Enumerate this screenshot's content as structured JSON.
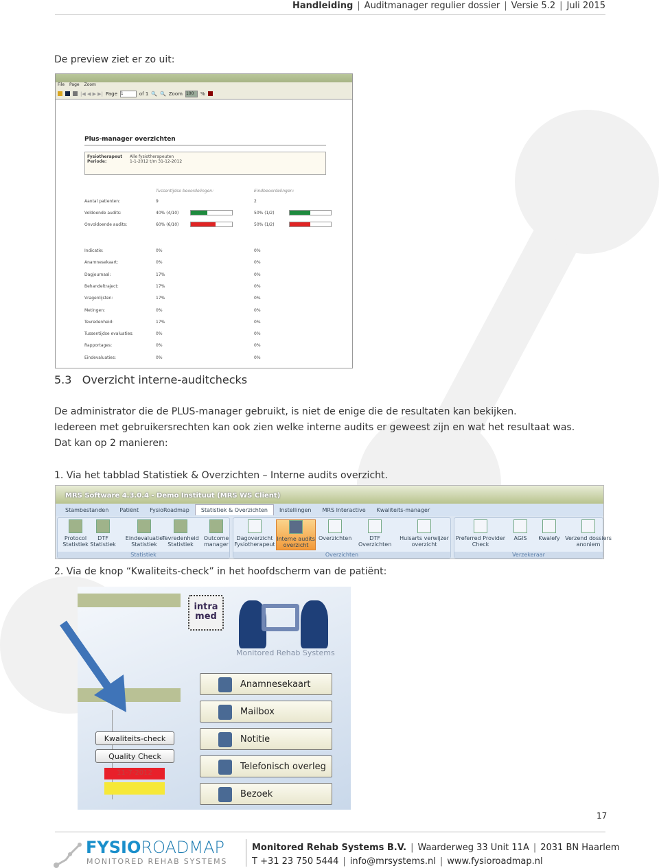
{
  "header": {
    "doc": "Handleiding",
    "title": "Auditmanager regulier dossier",
    "version": "Versie 5.2",
    "date": "Juli 2015"
  },
  "intro": "De preview ziet er zo uit:",
  "preview": {
    "menu": [
      "File",
      "Page",
      "Zoom"
    ],
    "page_label": "Page",
    "page_value": "1",
    "page_of": "of 1",
    "zoom_label": "Zoom",
    "zoom_value": "100",
    "zoom_unit": "%",
    "report_title": "Plus-manager overzichten",
    "therapist_label": "Fysiotherapeut",
    "therapist_value": "Alle fysiotherapeuten",
    "period_label": "Periode:",
    "period_value": "1-1-2012 t/m 31-12-2012",
    "col1": "Tussentijdse beoordelingen:",
    "col2": "Eindbeoordelingen:",
    "summary": [
      {
        "label": "Aantal patienten:",
        "v1": "9",
        "v2": "2"
      },
      {
        "label": "Voldoende audits:",
        "v1": "40% (4/10)",
        "v2": "50% (1/2)",
        "p1": 40,
        "p2": 50,
        "color": "#1e8a3e"
      },
      {
        "label": "Onvoldoende audits:",
        "v1": "60% (6/10)",
        "v2": "50% (1/2)",
        "p1": 60,
        "p2": 50,
        "color": "#e02424"
      }
    ],
    "rows": [
      {
        "label": "Indicatie:",
        "v1": "0%",
        "v2": "0%"
      },
      {
        "label": "Anamnesekaart:",
        "v1": "0%",
        "v2": "0%"
      },
      {
        "label": "Dagjournaal:",
        "v1": "17%",
        "v2": "0%"
      },
      {
        "label": "Behandeltraject:",
        "v1": "17%",
        "v2": "0%"
      },
      {
        "label": "Vragenlijsten:",
        "v1": "17%",
        "v2": "0%"
      },
      {
        "label": "Metingen:",
        "v1": "0%",
        "v2": "0%"
      },
      {
        "label": "Tevredenheid:",
        "v1": "17%",
        "v2": "0%"
      },
      {
        "label": "Tussentijdse evaluaties:",
        "v1": "0%",
        "v2": "0%"
      },
      {
        "label": "Rapportages:",
        "v1": "0%",
        "v2": "0%"
      },
      {
        "label": "Eindevaluaties:",
        "v1": "0%",
        "v2": "0%"
      }
    ]
  },
  "section": {
    "number": "5.3",
    "title": "Overzicht interne-auditchecks"
  },
  "para": [
    "De administrator die de PLUS-manager gebruikt, is niet de enige die de resultaten kan bekijken.",
    "Iedereen met gebruikersrechten kan ook zien welke interne audits er geweest zijn en wat het resultaat was.",
    "Dat kan op 2 manieren:"
  ],
  "step1": "1.   Via het tabblad Statistiek & Overzichten – Interne audits overzicht.",
  "ribbon": {
    "title": "MRS Software 4.3.0.4 - Demo Instituut (MRS WS Client)",
    "tabs": [
      "Stambestanden",
      "Patiënt",
      "FysioRoadmap",
      "Statistiek & Overzichten",
      "Instellingen",
      "MRS Interactive",
      "Kwaliteits-manager"
    ],
    "groups": [
      {
        "label": "Statistiek",
        "buttons": [
          "Protocol Statistiek",
          "DTF Statistiek",
          "Eindevaluatie Statistiek",
          "Tevredenheid Statistiek",
          "Outcome manager"
        ]
      },
      {
        "label": "Overzichten",
        "buttons": [
          "Dagoverzicht Fysiotherapeut",
          "Interne audits overzicht",
          "Overzichten",
          "DTF Overzichten",
          "Huisarts verwijzer overzicht"
        ]
      },
      {
        "label": "Verzekeraar",
        "buttons": [
          "Preferred Provider Check",
          "AGIS",
          "Kwalefy",
          "Verzend dossiers anoniem"
        ]
      }
    ]
  },
  "step2": "2.   Via de knop “Kwaliteits-check” in het hoofdscherm van de patiënt:",
  "home": {
    "logo": "intra med",
    "brand": "Monitored Rehab Systems",
    "buttons": [
      "Anamnesekaart",
      "Mailbox",
      "Notitie",
      "Telefonisch overleg",
      "Bezoek"
    ],
    "check_buttons": [
      "Kwaliteits-check",
      "Quality Check"
    ],
    "date_badge": "11-7-2012",
    "arrow_color": "#3f74b8"
  },
  "page_number": "17",
  "footer": {
    "logo_bold": "FYSIO",
    "logo_light": "ROADMAP",
    "logo_sub": "MONITORED REHAB SYSTEMS",
    "company": "Monitored Rehab Systems B.V.",
    "address": "Waarderweg 33  Unit 11A",
    "city": "2031 BN Haarlem",
    "phone": "T  +31 23 750 5444",
    "email": "info@mrsystems.nl",
    "web": "www.fysioroadmap.nl",
    "brand_color": "#1a8fcb"
  }
}
